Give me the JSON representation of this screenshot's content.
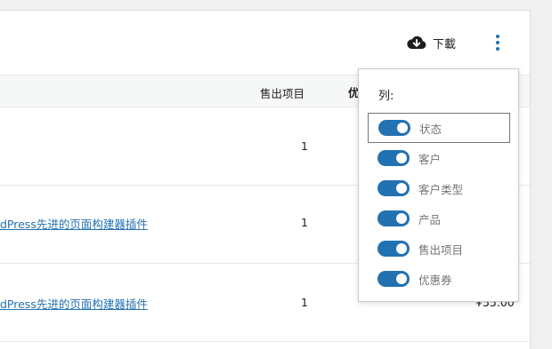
{
  "header": {
    "download_label": "下載",
    "download_icon": "cloud-download-icon",
    "more_icon": "vertical-ellipsis-icon"
  },
  "table": {
    "columns": {
      "sold": "售出项目",
      "coupon": "优"
    },
    "rows": [
      {
        "product": "",
        "sold": "1",
        "amount": ""
      },
      {
        "product": "dPress先进的页面构建器插件",
        "sold": "1",
        "amount": ""
      },
      {
        "product": "dPress先进的页面构建器插件",
        "sold": "1",
        "amount": "¥55.00"
      }
    ]
  },
  "columns_menu": {
    "title": "列:",
    "items": [
      {
        "label": "状态",
        "on": true
      },
      {
        "label": "客户",
        "on": true
      },
      {
        "label": "客户类型",
        "on": true
      },
      {
        "label": "产品",
        "on": true
      },
      {
        "label": "售出项目",
        "on": true
      },
      {
        "label": "优惠券",
        "on": true
      }
    ]
  },
  "colors": {
    "accent": "#2271b1",
    "link": "#2271b1",
    "header_bg": "#f6f7f7"
  }
}
